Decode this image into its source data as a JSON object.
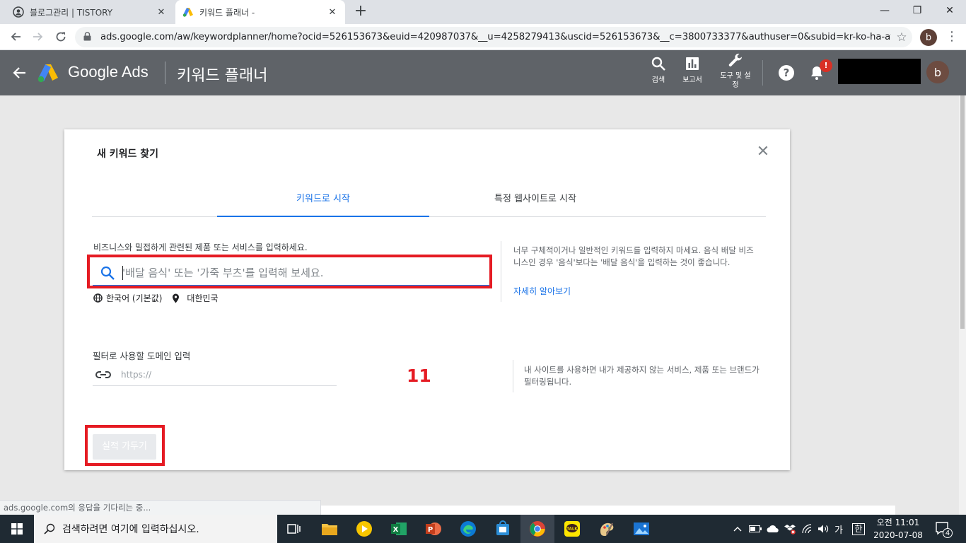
{
  "browser": {
    "tabs": [
      {
        "title": "블로그관리 | TISTORY",
        "icon": "account-circle-icon"
      },
      {
        "title": "키워드 플래너 -",
        "icon": "google-ads-icon"
      }
    ],
    "url": "ads.google.com/aw/keywordplanner/home?ocid=526153673&euid=420987037&__u=4258279413&uscid=526153673&__c=3800733377&authuser=0&subid=kr-ko-ha-aw-sk...",
    "profile_initial": "b"
  },
  "ads_header": {
    "brand": "Google Ads",
    "page_title": "키워드 플래너",
    "tools": [
      {
        "label": "검색",
        "icon": "search-icon"
      },
      {
        "label": "보고서",
        "icon": "bar-chart-icon"
      },
      {
        "label": "도구 및 설정",
        "icon": "wrench-icon"
      }
    ],
    "notification_badge": "!",
    "avatar_initial": "b"
  },
  "dialog": {
    "title": "새 키워드 찾기",
    "tabs": [
      "키워드로 시작",
      "특정 웹사이트로 시작"
    ],
    "prompt": "비즈니스와 밀접하게 관련된 제품 또는 서비스를 입력하세요.",
    "search_placeholder": "'배달 음식' 또는 '가죽 부츠'를 입력해 보세요.",
    "language": "한국어 (기본값)",
    "location": "대한민국",
    "help_text": "너무 구체적이거나 일반적인 키워드를 입력하지 마세요. 음식 배달 비즈니스인 경우 '음식'보다는 '배달 음식'을 입력하는 것이 좋습니다.",
    "help_link": "자세히 알아보기",
    "domain_label": "필터로 사용할 도메인 입력",
    "domain_placeholder": "https://",
    "annotation": "11",
    "domain_help": "내 사이트를 사용하면 내가 제공하지 않는 서비스, 제품 또는 브랜드가 필터링됩니다.",
    "submit_label": "실적 가두기"
  },
  "status_text": "ads.google.com의 응답을 기다리는 중...",
  "taskbar": {
    "search_placeholder": "검색하려면 여기에 입력하십시오.",
    "apps": [
      "task-view-icon",
      "file-explorer-icon",
      "media-player-icon",
      "excel-icon",
      "powerpoint-icon",
      "edge-icon",
      "store-icon",
      "chrome-icon",
      "kakaotalk-icon",
      "paint-icon",
      "photos-icon"
    ],
    "ime_lang": "가",
    "ime_mode": "한",
    "time": "오전 11:01",
    "date": "2020-07-08",
    "notification_count": "4"
  },
  "colors": {
    "accent": "#1a73e8",
    "ads_header": "#5f6368",
    "annotation_red": "#e51b23"
  }
}
